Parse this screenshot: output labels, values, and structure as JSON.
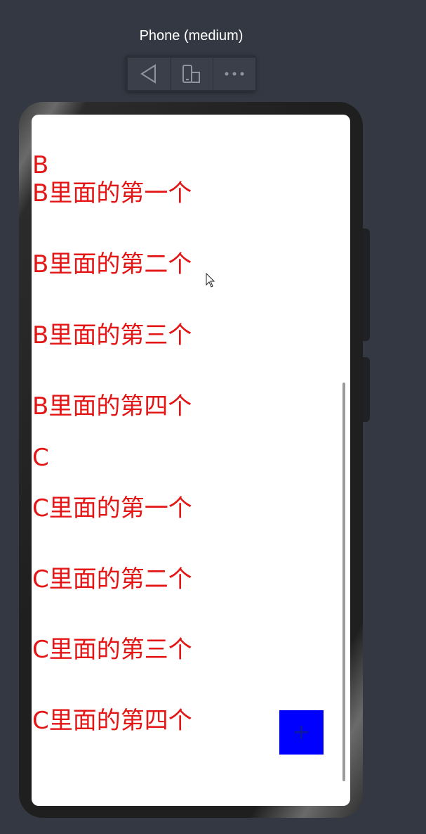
{
  "device": {
    "title": "Phone (medium)"
  },
  "toolbar": {
    "buttons": [
      {
        "icon": "back-triangle-icon"
      },
      {
        "icon": "rotate-device-icon"
      },
      {
        "icon": "more-dots-icon"
      }
    ]
  },
  "list": {
    "rows": [
      "B",
      "B里面的第一个",
      "B里面的第二个",
      "B里面的第三个",
      "B里面的第四个",
      "C",
      "C里面的第一个",
      "C里面的第二个",
      "C里面的第三个",
      "C里面的第四个"
    ]
  },
  "fab": {
    "label": "+"
  },
  "colors": {
    "background": "#343842",
    "list_text": "#e31515",
    "fab": "#0000ff",
    "screen": "#ffffff"
  }
}
